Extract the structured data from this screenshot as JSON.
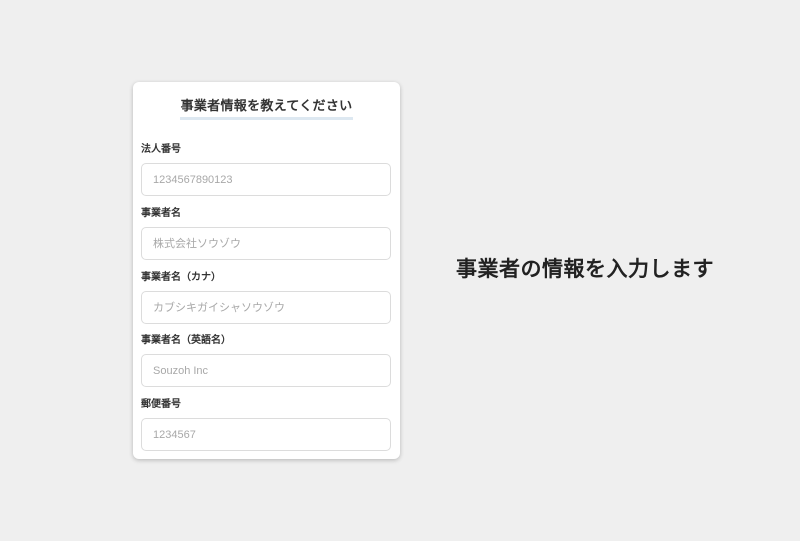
{
  "form": {
    "title": "事業者情報を教えてください",
    "fields": [
      {
        "label": "法人番号",
        "placeholder": "1234567890123",
        "value": ""
      },
      {
        "label": "事業者名",
        "placeholder": "株式会社ソウゾウ",
        "value": ""
      },
      {
        "label": "事業者名（カナ）",
        "placeholder": "カブシキガイシャソウゾウ",
        "value": ""
      },
      {
        "label": "事業者名（英語名）",
        "placeholder": "Souzoh Inc",
        "value": ""
      },
      {
        "label": "郵便番号",
        "placeholder": "1234567",
        "value": ""
      }
    ]
  },
  "caption": "事業者の情報を入力します",
  "colors": {
    "background": "#efefef",
    "card": "#ffffff",
    "title_underline": "#dde8f1",
    "input_border": "#dcdcdc",
    "placeholder": "#a8a8a8"
  }
}
